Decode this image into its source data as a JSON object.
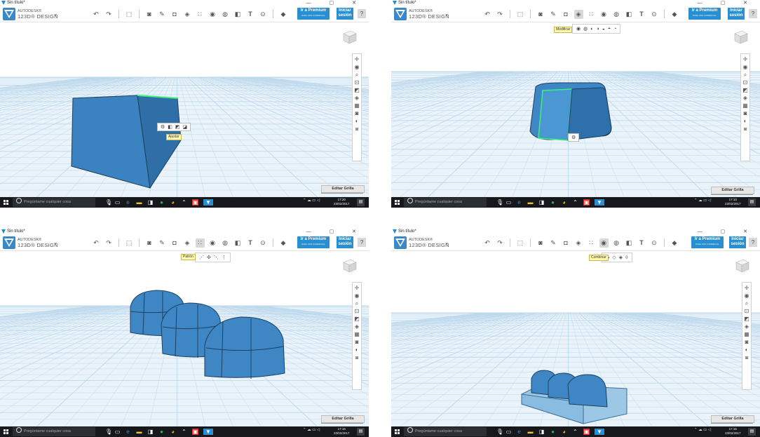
{
  "window": {
    "title": "Sin título*",
    "controls": "— ▢ ✕"
  },
  "app": {
    "brand_line1": "AUTODESK®",
    "brand_line2": "123D® DESIGN",
    "menu_chevron": "⌄"
  },
  "premium": {
    "label": "Ir a Premium",
    "sublabel": "PARA USO COMERCIAL"
  },
  "login": {
    "line1": "Iniciar",
    "line2": "sesión"
  },
  "help": {
    "label": "?"
  },
  "edit_grid": {
    "label": "Editar Grilla"
  },
  "taskbar": {
    "search_placeholder": "Pregúntame cualquier cosa"
  },
  "toolbar_icons": [
    "undo-icon",
    "redo-icon",
    "sep",
    "transform-icon",
    "sep",
    "primitives-icon",
    "sketch-icon",
    "construct-icon",
    "modify-icon",
    "pattern-icon",
    "grouping-icon",
    "combine-icon",
    "measure-icon",
    "text-icon",
    "snap-icon",
    "sep",
    "material-icon"
  ],
  "panels": [
    {
      "id": "top-left",
      "time": "17:20",
      "date": "23/02/2017",
      "selected_tool": "",
      "tooltip": "Ajustar",
      "submenu_tooltip": "",
      "scene": "tapered-box"
    },
    {
      "id": "top-right",
      "time": "17:10",
      "date": "23/02/2017",
      "selected_tool": "modify-icon",
      "tooltip": "",
      "submenu_tooltip": "Modificar",
      "scene": "rounded-box"
    },
    {
      "id": "bottom-left",
      "time": "17:16",
      "date": "23/02/2017",
      "selected_tool": "pattern-icon",
      "tooltip": "",
      "submenu_tooltip": "Patrón",
      "scene": "three-capsules"
    },
    {
      "id": "bottom-right",
      "time": "17:15",
      "date": "23/02/2017",
      "selected_tool": "grouping-icon",
      "tooltip": "",
      "submenu_tooltip": "Combinar",
      "scene": "combined-capsules"
    }
  ],
  "colors": {
    "accent": "#2a8fd0",
    "model_fill": "#3e87c4",
    "model_dark": "#2a6aa3",
    "grid_line": "#bcd8ec",
    "taskbar": "#16181b",
    "edge_highlight": "#3df07a"
  }
}
